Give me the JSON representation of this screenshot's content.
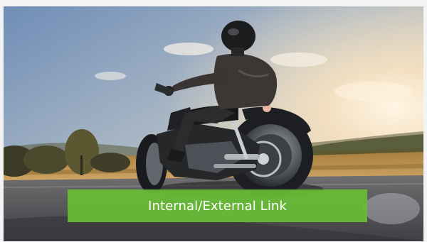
{
  "hero": {
    "image_icon": "motorcycle-rider-photo-icon"
  },
  "cta": {
    "label": "Internal/External Link",
    "background_color": "#68bc36",
    "text_color": "#ffffff"
  }
}
